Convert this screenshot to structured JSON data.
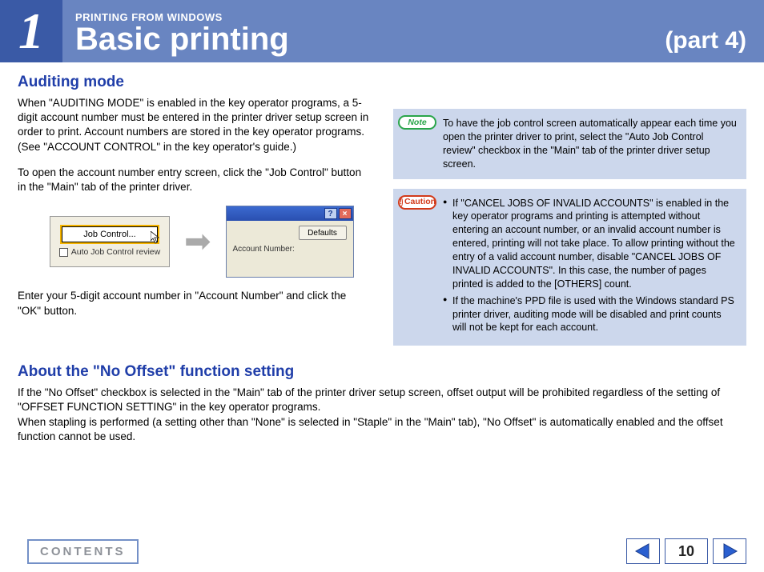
{
  "header": {
    "chapter_number": "1",
    "super_title": "PRINTING FROM WINDOWS",
    "title": "Basic printing",
    "part": "(part 4)"
  },
  "auditing": {
    "heading": "Auditing mode",
    "para1": "When \"AUDITING MODE\" is enabled in the key operator programs, a 5-digit account number must be entered in the printer driver setup screen in order to print. Account numbers are stored in the key operator programs. (See \"ACCOUNT CONTROL\" in the key operator's guide.)",
    "para2": "To open the account number entry screen, click the \"Job Control\" button in the \"Main\" tab of the printer driver.",
    "diagram": {
      "job_control_button": "Job Control...",
      "checkbox_label": "Auto Job Control review",
      "defaults_button": "Defaults",
      "account_label": "Account Number:"
    },
    "para3": "Enter your 5-digit account number in \"Account Number\" and click the \"OK\" button."
  },
  "note": {
    "badge": "Note",
    "text": "To have the job control screen automatically appear each time you open the printer driver to print, select the \"Auto Job Control review\" checkbox in the \"Main\" tab of the printer driver setup screen."
  },
  "caution": {
    "badge": "Caution",
    "bullets": [
      "If \"CANCEL JOBS OF INVALID ACCOUNTS\" is enabled in the key operator programs and printing is attempted without entering an account number, or an invalid account number is entered, printing will not take place. To allow printing without the entry of a valid account number, disable \"CANCEL JOBS OF INVALID ACCOUNTS\". In this case, the number of pages printed is added to the [OTHERS] count.",
      "If the machine's PPD file is used with the Windows standard PS printer driver, auditing mode will be disabled and print counts will not be kept for each account."
    ]
  },
  "nooffset": {
    "heading": "About the \"No Offset\" function setting",
    "para": "If the \"No Offset\" checkbox is selected in the \"Main\" tab of the printer driver setup screen, offset output will be prohibited regardless of the setting of \"OFFSET FUNCTION SETTING\" in the key operator programs.\nWhen stapling is performed (a setting other than \"None\" is selected in \"Staple\" in the \"Main\" tab), \"No Offset\" is automatically enabled and the offset function cannot be used."
  },
  "footer": {
    "contents": "CONTENTS",
    "page": "10"
  }
}
